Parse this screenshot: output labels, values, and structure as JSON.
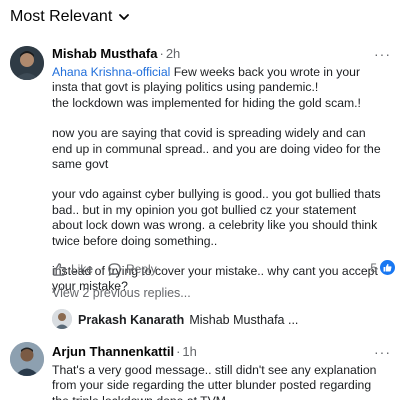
{
  "sort": {
    "label": "Most Relevant",
    "icon": "chevron-down-icon"
  },
  "comment1": {
    "author": "Mishab Musthafa",
    "separator": "·",
    "time": "2h",
    "more_label": "···",
    "mention": "Ahana Krishna-official",
    "line1_rest": " Few weeks back you wrote in your insta that govt is playing politics using pandemic.!",
    "line2": "the lockdown was implemented for hiding the gold scam.!",
    "para2": "now you are saying that covid is spreading widely and can end up in communal spread.. and you are doing video for the same govt",
    "para3": "your vdo against cyber bullying is good.. you got bullied thats bad.. but in my opinion you got bullied cz your statement about lock down was wrong. a celebrity like you should think twice before doing something..",
    "para4": "instead of trying to cover your mistake.. why cant you accept your mistake?",
    "like_label": "Like",
    "reply_label": "Reply",
    "reaction_count": "5"
  },
  "previous_replies": {
    "label": "View 2 previous replies..."
  },
  "reply_preview": {
    "author": "Prakash Kanarath",
    "text": "Mishab Musthafa ..."
  },
  "comment2": {
    "author": "Arjun Thannenkattil",
    "separator": "·",
    "time": "1h",
    "more_label": "···",
    "text": "That's a very good message.. still didn't see any explanation from your side regarding the utter blunder posted regarding the triple lockdown done at TVM..."
  },
  "colors": {
    "link": "#216fdb",
    "like_badge": "#1877f2",
    "muted": "#65676b"
  }
}
